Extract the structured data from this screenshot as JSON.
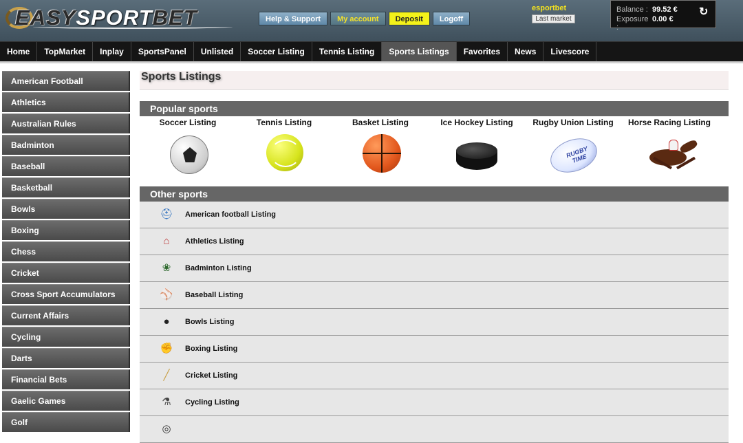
{
  "header": {
    "logo_left": "EASY",
    "logo_mid": "SPORT",
    "logo_right": "BET",
    "buttons": {
      "help": "Help & Support",
      "account": "My account",
      "deposit": "Deposit",
      "logoff": "Logoff"
    },
    "username": "esportbet",
    "last_market": "Last market",
    "balance_label": "Balance :",
    "balance_value": "99.52 €",
    "exposure_label": "Exposure :",
    "exposure_value": "0.00 €"
  },
  "nav": {
    "items": [
      "Home",
      "TopMarket",
      "Inplay",
      "SportsPanel",
      "Unlisted",
      "Soccer Listing",
      "Tennis Listing",
      "Sports Listings",
      "Favorites",
      "News",
      "Livescore"
    ],
    "active": "Sports Listings"
  },
  "sidebar": {
    "items": [
      "American Football",
      "Athletics",
      "Australian Rules",
      "Badminton",
      "Baseball",
      "Basketball",
      "Bowls",
      "Boxing",
      "Chess",
      "Cricket",
      "Cross Sport Accumulators",
      "Current Affairs",
      "Cycling",
      "Darts",
      "Financial Bets",
      "Gaelic Games",
      "Golf"
    ]
  },
  "main": {
    "title": "Sports Listings",
    "popular_header": "Popular sports",
    "popular": [
      {
        "label": "Soccer Listing",
        "icon": "soccer-ball-icon"
      },
      {
        "label": "Tennis Listing",
        "icon": "tennis-ball-icon"
      },
      {
        "label": "Basket Listing",
        "icon": "basketball-icon"
      },
      {
        "label": "Ice Hockey Listing",
        "icon": "hockey-puck-icon"
      },
      {
        "label": "Rugby Union Listing",
        "icon": "rugby-ball-icon"
      },
      {
        "label": "Horse Racing Listing",
        "icon": "racehorse-icon"
      }
    ],
    "rugby_ball_text": "RUGBY TIME",
    "other_header": "Other sports",
    "other": [
      {
        "label": "American football Listing",
        "icon": "football-helmet-icon"
      },
      {
        "label": "Athletics Listing",
        "icon": "hurdle-icon"
      },
      {
        "label": "Badminton Listing",
        "icon": "badminton-icon"
      },
      {
        "label": "Baseball Listing",
        "icon": "baseball-icon"
      },
      {
        "label": "Bowls Listing",
        "icon": "bowls-icon"
      },
      {
        "label": "Boxing Listing",
        "icon": "boxing-glove-icon"
      },
      {
        "label": "Cricket Listing",
        "icon": "cricket-bat-icon"
      },
      {
        "label": "Cycling Listing",
        "icon": "cyclist-icon"
      },
      {
        "label": "",
        "icon": "dartboard-icon"
      }
    ]
  }
}
